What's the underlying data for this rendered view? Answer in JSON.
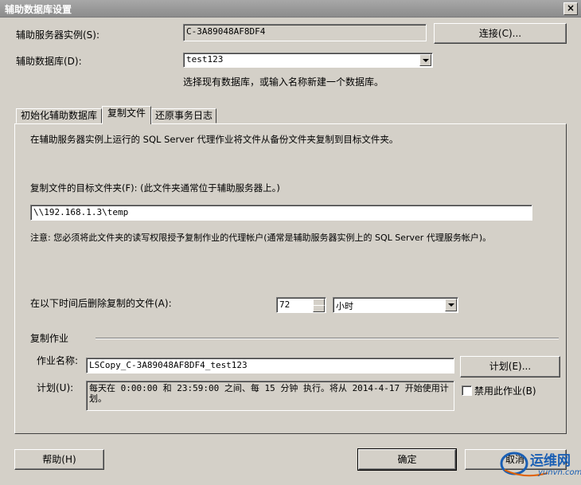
{
  "window": {
    "title": "辅助数据库设置",
    "close_label": "×"
  },
  "server": {
    "label": "辅助服务器实例(S):",
    "value": "C-3A89048AF8DF4",
    "connect_button": "连接(C)..."
  },
  "database": {
    "label": "辅助数据库(D):",
    "value": "test123",
    "hint": "选择现有数据库，或输入名称新建一个数据库。"
  },
  "tabs": [
    {
      "label": "初始化辅助数据库"
    },
    {
      "label": "复制文件"
    },
    {
      "label": "还原事务日志"
    }
  ],
  "copy_tab": {
    "description": "在辅助服务器实例上运行的 SQL Server 代理作业将文件从备份文件夹复制到目标文件夹。",
    "dest_label": "复制文件的目标文件夹(F): (此文件夹通常位于辅助服务器上。)",
    "dest_value": "\\\\192.168.1.3\\temp",
    "note": "注意: 您必须将此文件夹的读写权限授予复制作业的代理帐户(通常是辅助服务器实例上的 SQL Server 代理服务帐户)。",
    "delete_label": "在以下时间后删除复制的文件(A):",
    "delete_value": "72",
    "delete_unit": "小时",
    "job_group_label": "复制作业",
    "job_name_label": "作业名称:",
    "job_name_value": "LSCopy_C-3A89048AF8DF4_test123",
    "schedule_button": "计划(E)...",
    "schedule_label": "计划(U):",
    "schedule_text": "每天在 0:00:00 和 23:59:00 之间、每 15 分钟 执行。将从 2014-4-17 开始使用计划。",
    "disable_label": "禁用此作业(B)"
  },
  "footer": {
    "help_button": "帮助(H)",
    "ok_button": "确定",
    "cancel_button": "取消"
  },
  "watermark": {
    "text": "运维网",
    "sub": "yunvn.com",
    "accent": "#1a5fb4"
  }
}
